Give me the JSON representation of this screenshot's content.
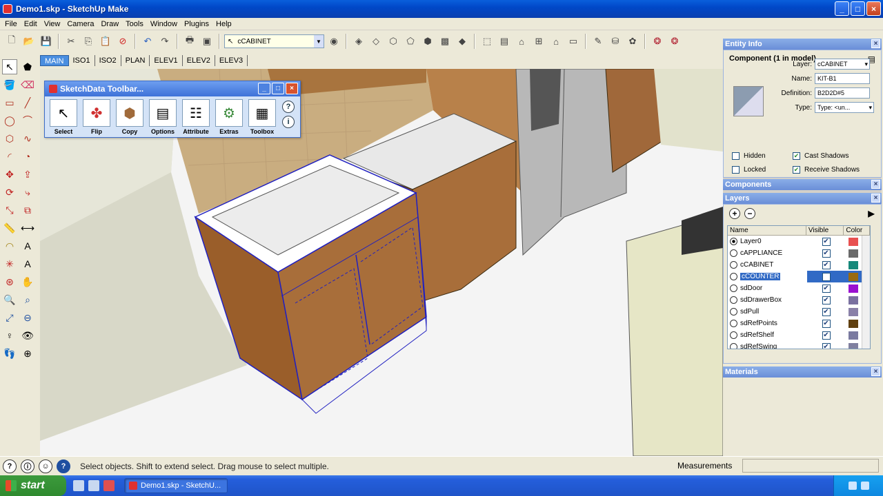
{
  "window": {
    "title": "Demo1.skp - SketchUp Make",
    "min": "_",
    "max": "□",
    "close": "×"
  },
  "menu": [
    "File",
    "Edit",
    "View",
    "Camera",
    "Draw",
    "Tools",
    "Window",
    "Plugins",
    "Help"
  ],
  "toolbar": {
    "layer_value": "cCABINET",
    "layer_cursor": "↖"
  },
  "scene_tabs": [
    "MAIN",
    "ISO1",
    "ISO2",
    "PLAN",
    "ELEV1",
    "ELEV2",
    "ELEV3"
  ],
  "sketchdata": {
    "title": "SketchData Toolbar...",
    "tools": [
      "Select",
      "Flip",
      "Copy",
      "Options",
      "Attribute",
      "Extras",
      "Toolbox"
    ],
    "help_q": "?",
    "help_i": "i"
  },
  "entity_info": {
    "header": "Entity Info",
    "component": "Component (1 in model)",
    "layer_label": "Layer:",
    "layer_value": "cCABINET",
    "name_label": "Name:",
    "name_value": "KIT-B1",
    "definition_label": "Definition:",
    "definition_value": "B2D2D#5",
    "type_label": "Type:",
    "type_value": "Type: <un...",
    "hidden": "Hidden",
    "locked": "Locked",
    "cast_shadows": "Cast Shadows",
    "receive_shadows": "Receive Shadows"
  },
  "components_header": "Components",
  "layers": {
    "header": "Layers",
    "cols": {
      "name": "Name",
      "visible": "Visible",
      "color": "Color"
    },
    "add": "+",
    "remove": "−",
    "rows": [
      {
        "name": "Layer0",
        "color": "#e85050"
      },
      {
        "name": "cAPPLIANCE",
        "color": "#6a6a6a"
      },
      {
        "name": "cCABINET",
        "color": "#16887a"
      },
      {
        "name": "cCOUNTER",
        "color": "#9a6a10"
      },
      {
        "name": "sdDoor",
        "color": "#9a10d0"
      },
      {
        "name": "sdDrawerBox",
        "color": "#7a70a0"
      },
      {
        "name": "sdPull",
        "color": "#8a80a8"
      },
      {
        "name": "sdRefPoints",
        "color": "#604010"
      },
      {
        "name": "sdRefShelf",
        "color": "#7a7aa0"
      },
      {
        "name": "sdRefSwing",
        "color": "#8080a0"
      }
    ]
  },
  "materials_header": "Materials",
  "status": {
    "text": "Select objects. Shift to extend select. Drag mouse to select multiple.",
    "measurements": "Measurements"
  },
  "taskbar": {
    "start": "start",
    "task": "Demo1.skp - SketchU..."
  }
}
